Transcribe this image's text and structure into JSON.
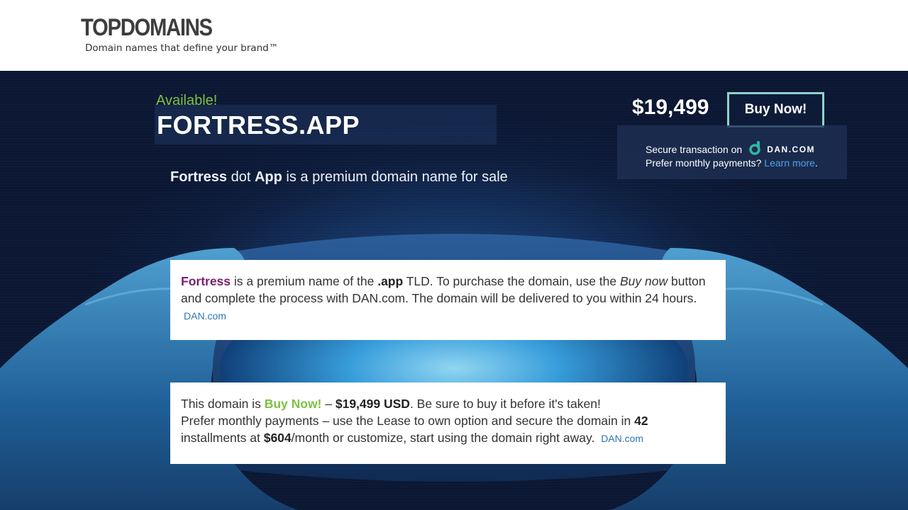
{
  "header": {
    "logo": "TOPDOMAINS",
    "tagline": "Domain names that define your brand™"
  },
  "hero": {
    "available_label": "Available!",
    "domain_name": "FORTRESS.APP",
    "subtitle_part1": "Fortress",
    "subtitle_part2": " dot ",
    "subtitle_part3": "App",
    "subtitle_part4": " is a premium domain name for sale",
    "price": "$19,499",
    "buy_button": "Buy Now!",
    "secure_text": "Secure transaction on",
    "dan_brand": "DAN.COM",
    "monthly_text": "Prefer monthly payments?",
    "learn_more": "Learn more",
    "learn_more_suffix": "."
  },
  "card1": {
    "name": "Fortress",
    "t1": " is a premium name of the ",
    "tld": ".app",
    "t2": " TLD. To purchase the domain, use the ",
    "buy_now_italic": "Buy now",
    "t3": " button and complete the process with DAN.com. The domain will be delivered to you within 24 hours.",
    "link": "DAN.com"
  },
  "card2": {
    "t1": "This domain is ",
    "status": "Buy Now!",
    "t2": " – ",
    "price_usd": "$19,499 USD",
    "t3": ". Be sure to buy it before it's taken!",
    "t4": "Prefer monthly payments – use the Lease to own option and secure the domain in ",
    "installments": "42",
    "t5": " installments at ",
    "monthly": "$604",
    "t6": "/month or customize, start using the domain right away.",
    "link": "DAN.com"
  },
  "colors": {
    "accent_green": "#7cc242",
    "brand_purple": "#7a1f6f",
    "link_blue": "#2f75b5",
    "button_border": "#8fd3c8",
    "hero_bg": "#0d1d3d"
  }
}
